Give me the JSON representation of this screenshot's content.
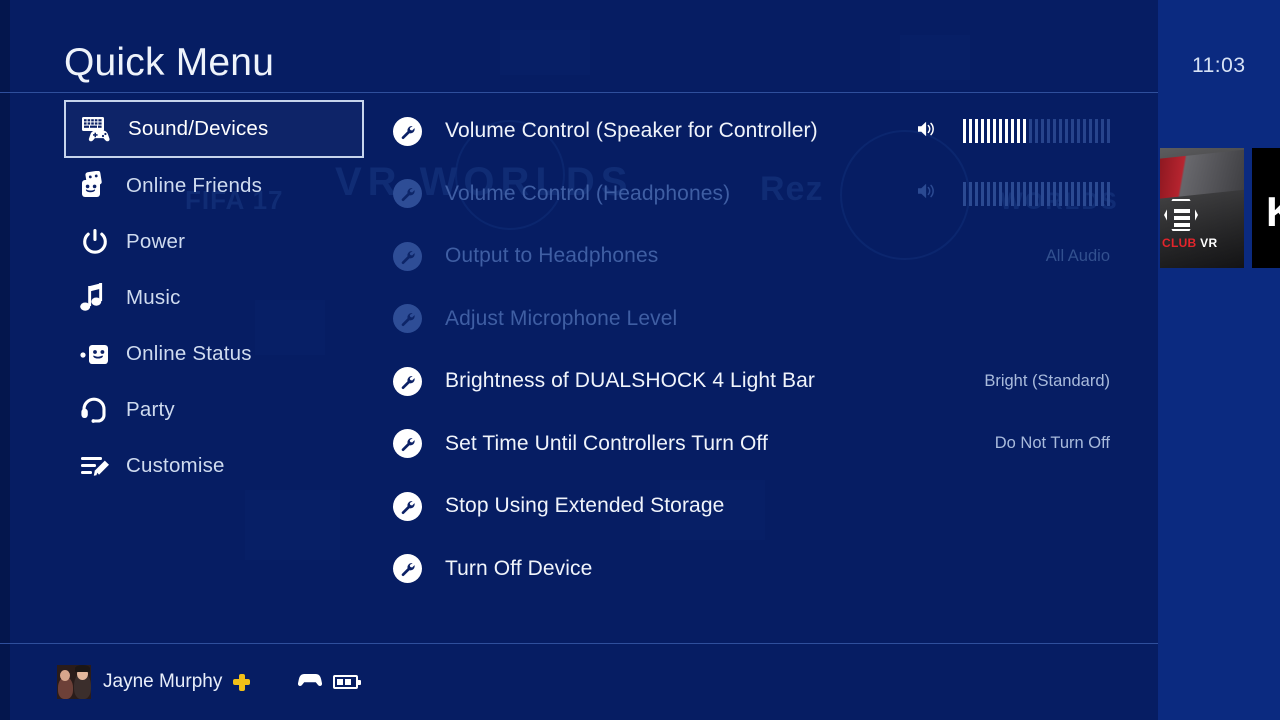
{
  "header": {
    "title": "Quick Menu"
  },
  "home_screen": {
    "clock": "11:03",
    "tiles": [
      {
        "name": "DRIVECLUB VR",
        "label_red": "CLUB",
        "label_white": "VR"
      },
      {
        "name": "KI",
        "label": "KI"
      }
    ]
  },
  "background_art": {
    "items": [
      "FIFA 17",
      "VR WORLDS",
      "Rez",
      "WORLDS"
    ]
  },
  "sidebar": {
    "items": [
      {
        "label": "Sound/Devices",
        "icon": "keyboard-controller-icon",
        "selected": true
      },
      {
        "label": "Online Friends",
        "icon": "friends-icon",
        "selected": false
      },
      {
        "label": "Power",
        "icon": "power-icon",
        "selected": false
      },
      {
        "label": "Music",
        "icon": "music-note-icon",
        "selected": false
      },
      {
        "label": "Online Status",
        "icon": "online-status-icon",
        "selected": false
      },
      {
        "label": "Party",
        "icon": "headset-icon",
        "selected": false
      },
      {
        "label": "Customise",
        "icon": "customise-pencil-icon",
        "selected": false
      }
    ]
  },
  "main": {
    "rows": [
      {
        "label": "Volume Control (Speaker for Controller)",
        "icon": "wrench-icon",
        "dimmed": false,
        "control": "volume",
        "speaker_icon": "speaker-icon",
        "volume_filled": 11,
        "volume_total": 25,
        "value": ""
      },
      {
        "label": "Volume Control (Headphones)",
        "icon": "wrench-icon",
        "dimmed": true,
        "control": "volume",
        "speaker_icon": "speaker-icon",
        "volume_filled": 0,
        "volume_total": 25,
        "value": ""
      },
      {
        "label": "Output to Headphones",
        "icon": "wrench-icon",
        "dimmed": true,
        "control": "value",
        "value": "All Audio"
      },
      {
        "label": "Adjust Microphone Level",
        "icon": "wrench-icon",
        "dimmed": true,
        "control": "none",
        "value": ""
      },
      {
        "label": "Brightness of DUALSHOCK 4 Light Bar",
        "icon": "wrench-icon",
        "dimmed": false,
        "control": "value",
        "value": "Bright (Standard)"
      },
      {
        "label": "Set Time Until Controllers Turn Off",
        "icon": "wrench-icon",
        "dimmed": false,
        "control": "value",
        "value": "Do Not Turn Off"
      },
      {
        "label": "Stop Using Extended Storage",
        "icon": "wrench-icon",
        "dimmed": false,
        "control": "none",
        "value": ""
      },
      {
        "label": "Turn Off Device",
        "icon": "wrench-icon",
        "dimmed": false,
        "control": "none",
        "value": ""
      }
    ]
  },
  "footer": {
    "user_name": "Jayne Murphy",
    "avatar": "user-avatar",
    "plus_badge": "playstation-plus-icon",
    "controller_icon": "controller-icon",
    "battery_icon": "battery-icon",
    "battery_bars": 2
  },
  "colors": {
    "panel_bg": "#061d63",
    "home_bg": "#0b2a80",
    "rule": "#2f4f9c",
    "text": "#f0f4fb",
    "text_dim": "#3f5ea3",
    "value_text": "#a9bbdc",
    "selected_border": "#c6d4ec",
    "plus_gold": "#f2c017",
    "tile_red": "#e3242b"
  }
}
